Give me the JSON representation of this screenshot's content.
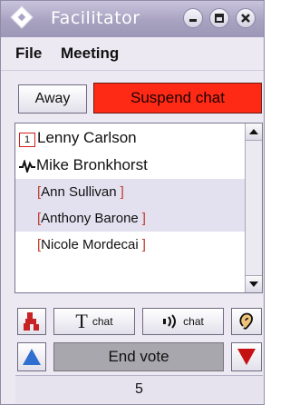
{
  "window": {
    "title": "Facilitator",
    "controls": [
      "minimize-icon",
      "maximize-icon",
      "close-icon"
    ]
  },
  "menu": {
    "items": [
      {
        "label": "File"
      },
      {
        "label": "Meeting"
      }
    ]
  },
  "actions": {
    "away_label": "Away",
    "suspend_label": "Suspend chat",
    "suspend_color": "#ff2a16"
  },
  "participants": [
    {
      "badge": "1",
      "name": "Lenny Carlson",
      "icon": "speaker-number-badge",
      "highlighted": false
    },
    {
      "name": "Mike Bronkhorst",
      "icon": "signal-wave-icon",
      "highlighted": false
    },
    {
      "name": "Ann Sullivan",
      "bracketed": true,
      "highlighted": true
    },
    {
      "name": "Anthony Barone",
      "bracketed": true,
      "highlighted": true
    },
    {
      "name": "Nicole Mordecai",
      "bracketed": true,
      "highlighted": false
    }
  ],
  "brackets": {
    "open": "[",
    "close": "]"
  },
  "toolbar": {
    "text_chat_glyph": "T",
    "text_chat_label": "chat",
    "voice_chat_label": "chat",
    "voice_chat_icon": "sound-waves-icon",
    "left_icon": "raised-hand-icon",
    "right_icon": "ear-icon"
  },
  "vote": {
    "end_vote_label": "End vote",
    "up_icon": "vote-up-triangle-icon",
    "down_icon": "vote-down-triangle-icon",
    "up_color": "#2e6fd0",
    "down_color": "#c41212"
  },
  "status": {
    "count": "5"
  }
}
